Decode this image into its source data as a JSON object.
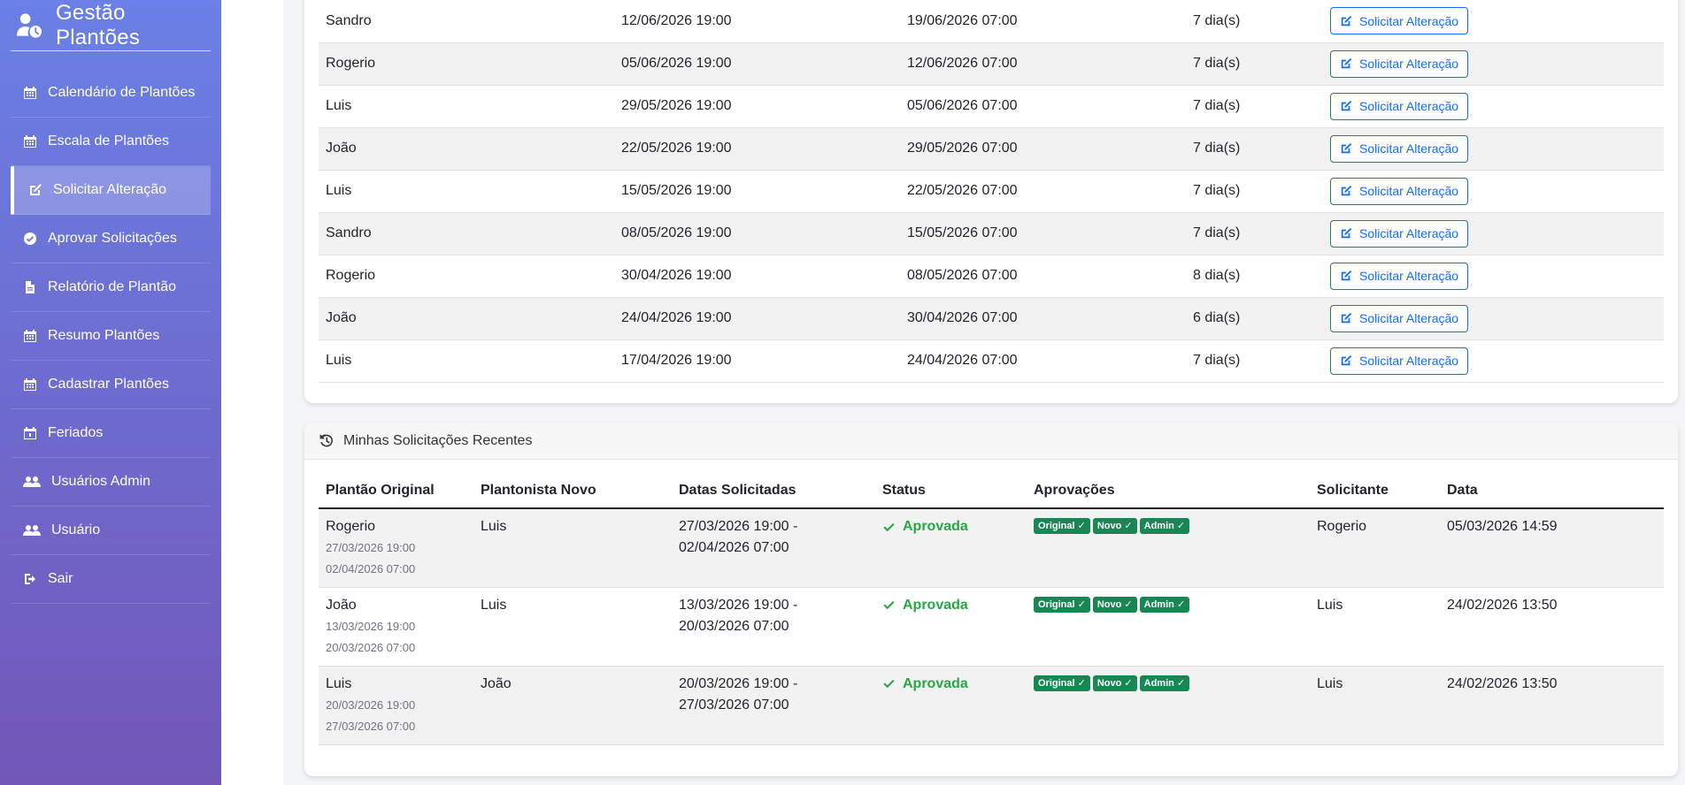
{
  "app": {
    "title": "Gestão Plantões"
  },
  "sidebar": {
    "items": [
      {
        "label": "Calendário de Plantões",
        "icon": "calendar-icon"
      },
      {
        "label": "Escala de Plantões",
        "icon": "calendar-icon"
      },
      {
        "label": "Solicitar Alteração",
        "icon": "edit-icon",
        "active": true
      },
      {
        "label": "Aprovar Solicitações",
        "icon": "check-circle-icon"
      },
      {
        "label": "Relatório de Plantão",
        "icon": "pdf-file-icon"
      },
      {
        "label": "Resumo Plantões",
        "icon": "calendar-icon"
      },
      {
        "label": "Cadastrar Plantões",
        "icon": "calendar-icon"
      },
      {
        "label": "Feriados",
        "icon": "calendar-day-icon"
      },
      {
        "label": "Usuários Admin",
        "icon": "users-icon"
      },
      {
        "label": "Usuário",
        "icon": "users-icon"
      },
      {
        "label": "Sair",
        "icon": "sign-out-icon"
      }
    ]
  },
  "shifts": {
    "action_label": "Solicitar Alteração",
    "rows": [
      [
        "Sandro",
        "12/06/2026 19:00",
        "19/06/2026 07:00",
        "7 dia(s)"
      ],
      [
        "Rogerio",
        "05/06/2026 19:00",
        "12/06/2026 07:00",
        "7 dia(s)"
      ],
      [
        "Luis",
        "29/05/2026 19:00",
        "05/06/2026 07:00",
        "7 dia(s)"
      ],
      [
        "João",
        "22/05/2026 19:00",
        "29/05/2026 07:00",
        "7 dia(s)"
      ],
      [
        "Luis",
        "15/05/2026 19:00",
        "22/05/2026 07:00",
        "7 dia(s)"
      ],
      [
        "Sandro",
        "08/05/2026 19:00",
        "15/05/2026 07:00",
        "7 dia(s)"
      ],
      [
        "Rogerio",
        "30/04/2026 19:00",
        "08/05/2026 07:00",
        "8 dia(s)"
      ],
      [
        "João",
        "24/04/2026 19:00",
        "30/04/2026 07:00",
        "6 dia(s)"
      ],
      [
        "Luis",
        "17/04/2026 19:00",
        "24/04/2026 07:00",
        "7 dia(s)"
      ]
    ]
  },
  "requests": {
    "title": "Minhas Solicitações Recentes",
    "headers": [
      "Plantão Original",
      "Plantonista Novo",
      "Datas Solicitadas",
      "Status",
      "Aprovações",
      "Solicitante",
      "Data"
    ],
    "badges": [
      "Original ✓",
      "Novo ✓",
      "Admin ✓"
    ],
    "rows": [
      {
        "original": "Rogerio",
        "orig_start": "27/03/2026 19:00",
        "orig_end": "02/04/2026 07:00",
        "novo": "Luis",
        "dates_1": "27/03/2026 19:00 -",
        "dates_2": "02/04/2026 07:00",
        "status": "Aprovada",
        "solicitante": "Rogerio",
        "data": "05/03/2026 14:59"
      },
      {
        "original": "João",
        "orig_start": "13/03/2026 19:00",
        "orig_end": "20/03/2026 07:00",
        "novo": "Luis",
        "dates_1": "13/03/2026 19:00 -",
        "dates_2": "20/03/2026 07:00",
        "status": "Aprovada",
        "solicitante": "Luis",
        "data": "24/02/2026 13:50"
      },
      {
        "original": "Luis",
        "orig_start": "20/03/2026 19:00",
        "orig_end": "27/03/2026 07:00",
        "novo": "João",
        "dates_1": "20/03/2026 19:00 -",
        "dates_2": "27/03/2026 07:00",
        "status": "Aprovada",
        "solicitante": "Luis",
        "data": "24/02/2026 13:50"
      }
    ]
  },
  "colors": {
    "accent": "#0d6efd",
    "success": "#28a745",
    "badge": "#198754",
    "sidebar_top": "#6a80e6",
    "sidebar_bottom": "#7257b8"
  }
}
